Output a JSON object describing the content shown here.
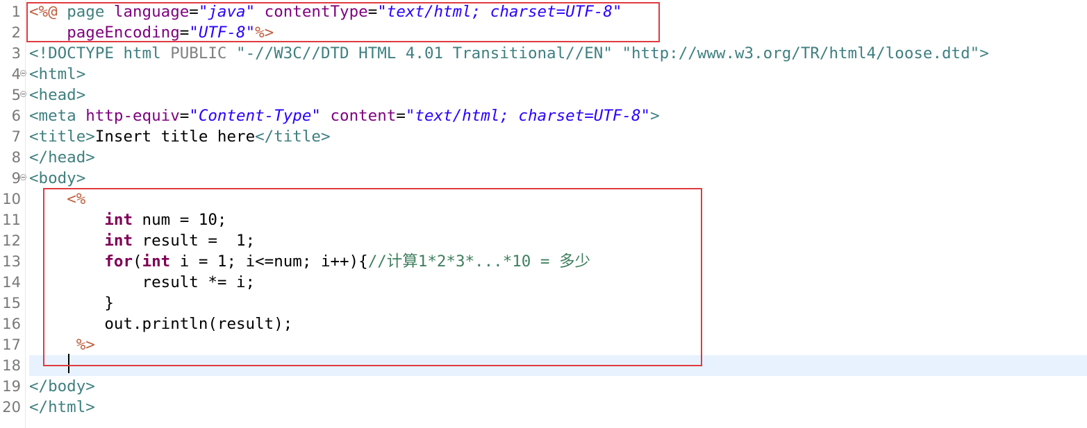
{
  "editor": {
    "language": "jsp",
    "current_line": 18,
    "colors": {
      "jsp_delimiter": "#bf5f3f",
      "tag_name": "#3f7f7f",
      "attribute_name": "#7f007f",
      "attribute_value": "#2a00ff",
      "java_keyword": "#7f0055",
      "comment": "#3f7f5f",
      "current_line_highlight": "#e8f2fe",
      "annotation_border": "#e03a3e"
    },
    "lines": [
      {
        "number": "1",
        "fold": false,
        "tokens": [
          {
            "type": "delim",
            "text": "<%@"
          },
          {
            "type": "plain",
            "text": " "
          },
          {
            "type": "dir",
            "text": "page"
          },
          {
            "type": "plain",
            "text": " "
          },
          {
            "type": "attr",
            "text": "language"
          },
          {
            "type": "plain",
            "text": "="
          },
          {
            "type": "str",
            "text": "\"java\""
          },
          {
            "type": "plain",
            "text": " "
          },
          {
            "type": "attr",
            "text": "contentType"
          },
          {
            "type": "plain",
            "text": "="
          },
          {
            "type": "str",
            "text": "\"text/html; charset=UTF-8\""
          }
        ]
      },
      {
        "number": "2",
        "fold": false,
        "tokens": [
          {
            "type": "plain",
            "text": "    "
          },
          {
            "type": "attr",
            "text": "pageEncoding"
          },
          {
            "type": "plain",
            "text": "="
          },
          {
            "type": "str",
            "text": "\"UTF-8\""
          },
          {
            "type": "delim",
            "text": "%>"
          }
        ]
      },
      {
        "number": "3",
        "fold": false,
        "tokens": [
          {
            "type": "doctype",
            "text": "<!DOCTYPE html "
          },
          {
            "type": "public",
            "text": "PUBLIC"
          },
          {
            "type": "plain",
            "text": " "
          },
          {
            "type": "dtdstr",
            "text": "\"-//W3C//DTD HTML 4.01 Transitional//EN\""
          },
          {
            "type": "plain",
            "text": " "
          },
          {
            "type": "dtdstr",
            "text": "\"http://www.w3.org/TR/html4/loose.dtd\""
          },
          {
            "type": "doctype",
            "text": ">"
          }
        ]
      },
      {
        "number": "4",
        "fold": true,
        "tokens": [
          {
            "type": "tag",
            "text": "<html>"
          }
        ]
      },
      {
        "number": "5",
        "fold": true,
        "tokens": [
          {
            "type": "tag",
            "text": "<head>"
          }
        ]
      },
      {
        "number": "6",
        "fold": false,
        "tokens": [
          {
            "type": "tag",
            "text": "<meta "
          },
          {
            "type": "attr",
            "text": "http-equiv"
          },
          {
            "type": "plain",
            "text": "="
          },
          {
            "type": "str",
            "text": "\"Content-Type\""
          },
          {
            "type": "plain",
            "text": " "
          },
          {
            "type": "attr",
            "text": "content"
          },
          {
            "type": "plain",
            "text": "="
          },
          {
            "type": "str",
            "text": "\"text/html; charset=UTF-8\""
          },
          {
            "type": "tag",
            "text": ">"
          }
        ]
      },
      {
        "number": "7",
        "fold": false,
        "tokens": [
          {
            "type": "tag",
            "text": "<title>"
          },
          {
            "type": "plain",
            "text": "Insert title here"
          },
          {
            "type": "tag",
            "text": "</title>"
          }
        ]
      },
      {
        "number": "8",
        "fold": false,
        "tokens": [
          {
            "type": "tag",
            "text": "</head>"
          }
        ]
      },
      {
        "number": "9",
        "fold": true,
        "tokens": [
          {
            "type": "tag",
            "text": "<body>"
          }
        ]
      },
      {
        "number": "10",
        "fold": false,
        "tokens": [
          {
            "type": "plain",
            "text": "    "
          },
          {
            "type": "delim",
            "text": "<%"
          }
        ]
      },
      {
        "number": "11",
        "fold": false,
        "tokens": [
          {
            "type": "plain",
            "text": "        "
          },
          {
            "type": "kw",
            "text": "int"
          },
          {
            "type": "plain",
            "text": " num = 10;"
          }
        ]
      },
      {
        "number": "12",
        "fold": false,
        "tokens": [
          {
            "type": "plain",
            "text": "        "
          },
          {
            "type": "kw",
            "text": "int"
          },
          {
            "type": "plain",
            "text": " result =  1;"
          }
        ]
      },
      {
        "number": "13",
        "fold": false,
        "tokens": [
          {
            "type": "plain",
            "text": "        "
          },
          {
            "type": "kw",
            "text": "for"
          },
          {
            "type": "plain",
            "text": "("
          },
          {
            "type": "kw",
            "text": "int"
          },
          {
            "type": "plain",
            "text": " i = 1; i<=num; i++){"
          },
          {
            "type": "cmt",
            "text": "//计算1*2*3*...*10 = 多少"
          }
        ]
      },
      {
        "number": "14",
        "fold": false,
        "tokens": [
          {
            "type": "plain",
            "text": "            result *= i;"
          }
        ]
      },
      {
        "number": "15",
        "fold": false,
        "tokens": [
          {
            "type": "plain",
            "text": "        }"
          }
        ]
      },
      {
        "number": "16",
        "fold": false,
        "tokens": [
          {
            "type": "plain",
            "text": "        out.println(result);"
          }
        ]
      },
      {
        "number": "17",
        "fold": false,
        "tokens": [
          {
            "type": "plain",
            "text": "     "
          },
          {
            "type": "delim",
            "text": "%>"
          }
        ]
      },
      {
        "number": "18",
        "fold": false,
        "tokens": []
      },
      {
        "number": "19",
        "fold": false,
        "tokens": [
          {
            "type": "tag",
            "text": "</body>"
          }
        ]
      },
      {
        "number": "20",
        "fold": false,
        "tokens": [
          {
            "type": "tag",
            "text": "</html>"
          }
        ]
      }
    ]
  }
}
